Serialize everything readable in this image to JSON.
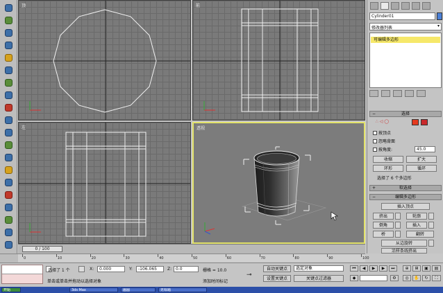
{
  "viewports": {
    "top": {
      "label": "顶"
    },
    "front": {
      "label": "前"
    },
    "left": {
      "label": "左"
    },
    "perspective": {
      "label": "透视"
    }
  },
  "command_panel": {
    "object_name": "Cylinder01",
    "modifier_list": "修改器列表",
    "stack_item": "可编辑多边形",
    "selection": {
      "title": "选择",
      "by_vertex": "按顶点",
      "ignore_backfacing": "忽略背面",
      "by_angle": "按角度:",
      "angle_value": "45.0",
      "shrink": "收缩",
      "grow": "扩大",
      "ring": "环形",
      "loop": "循环",
      "selected_status": "选择了 6 个多边形"
    },
    "soft_selection": {
      "title": "软选择"
    },
    "edit_polygons": {
      "title": "编辑多边形",
      "insert_vertex": "插入顶点",
      "extrude": "挤出",
      "outline": "轮廓",
      "bevel": "倒角",
      "inset": "插入",
      "bridge": "桥",
      "flip": "翻转",
      "hinge_from_edge": "从边旋转",
      "extrude_along_spline": "沿样条线挤出"
    }
  },
  "timeline": {
    "time_slider": "0 / 100"
  },
  "ruler": {
    "ticks": [
      "0",
      "10",
      "20",
      "30",
      "40",
      "50",
      "60",
      "70",
      "80",
      "90",
      "100"
    ]
  },
  "status": {
    "selected_count": "选择了 1 个",
    "prompt": "单击或单击并拖动以选择对象",
    "x_label": "X:",
    "x_value": "0.000",
    "y_label": "Y:",
    "y_value": "-106.065",
    "z_label": "Z:",
    "z_value": "0.0",
    "grid": "栅格 = 10.0",
    "add_time_tag": "添加时间标记",
    "auto_key": "自动关键点",
    "set_key": "设置关键点",
    "selected_dropdown": "选定对象",
    "key_filters": "关键点过滤器"
  },
  "taskbar": {
    "items": [
      "开始",
      "3ds Max",
      "画图",
      "无标题"
    ]
  },
  "colors": {
    "active_viewport_border": "#e3e36a",
    "stack_highlight": "#f6e86a",
    "object_color": "#4a7fd6"
  }
}
